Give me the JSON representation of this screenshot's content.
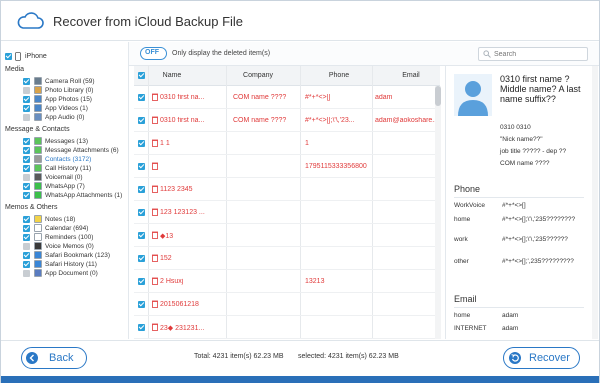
{
  "header": {
    "title": "Recover from iCloud Backup File"
  },
  "toolbar": {
    "toggle_label": "OFF",
    "toggle_desc": "Only display the deleted item(s)",
    "search_placeholder": "Search"
  },
  "sidebar": {
    "root": "iPhone",
    "sections": [
      {
        "title": "Media",
        "items": [
          {
            "label": "Camera Roll (59)",
            "checked": true,
            "icon_color": "#6a7d8e"
          },
          {
            "label": "Photo Library (0)",
            "checked": false,
            "icon_color": "#d8a24a"
          },
          {
            "label": "App Photos (15)",
            "checked": true,
            "icon_color": "#4a86c8"
          },
          {
            "label": "App Videos (1)",
            "checked": true,
            "icon_color": "#4a86c8"
          },
          {
            "label": "App Audio (0)",
            "checked": false,
            "icon_color": "#6a8fc0"
          }
        ]
      },
      {
        "title": "Message & Contacts",
        "items": [
          {
            "label": "Messages (13)",
            "checked": true,
            "icon_color": "#5cc45a"
          },
          {
            "label": "Message Attachments (6)",
            "checked": true,
            "icon_color": "#5cc45a"
          },
          {
            "label": "Contacts (3172)",
            "checked": true,
            "icon_color": "#9a9a9a",
            "selected": true
          },
          {
            "label": "Call History (11)",
            "checked": true,
            "icon_color": "#5cc45a"
          },
          {
            "label": "Voicemail (0)",
            "checked": false,
            "icon_color": "#5a5a5a"
          },
          {
            "label": "WhatsApp (7)",
            "checked": true,
            "icon_color": "#3cbf4b"
          },
          {
            "label": "WhatsApp Attachments (1)",
            "checked": true,
            "icon_color": "#3cbf4b"
          }
        ]
      },
      {
        "title": "Memos & Others",
        "items": [
          {
            "label": "Notes (18)",
            "checked": true,
            "icon_color": "#f2d34a"
          },
          {
            "label": "Calendar (694)",
            "checked": true,
            "icon_color": "#ffffff"
          },
          {
            "label": "Reminders (100)",
            "checked": true,
            "icon_color": "#ffffff"
          },
          {
            "label": "Voice Memos (0)",
            "checked": false,
            "icon_color": "#3a3a3a"
          },
          {
            "label": "Safari Bookmark (123)",
            "checked": true,
            "icon_color": "#3a86d6"
          },
          {
            "label": "Safari History (11)",
            "checked": true,
            "icon_color": "#3a86d6"
          },
          {
            "label": "App Document (0)",
            "checked": false,
            "icon_color": "#5a7cc0"
          }
        ]
      }
    ]
  },
  "table": {
    "columns": [
      "Name",
      "Company",
      "Phone",
      "Email"
    ],
    "rows": [
      {
        "name": "0310 first na...",
        "company": "COM name ????",
        "phone": "#*+*<>[]",
        "email": "adam"
      },
      {
        "name": "0310 first na...",
        "company": "COM name ????",
        "phone": "#*+*<>[];\\'\\,'23...",
        "email": "adam@aokoshare..."
      },
      {
        "name": "1 1",
        "company": "",
        "phone": "1",
        "email": ""
      },
      {
        "name": "",
        "company": "",
        "phone": "1795115333356800",
        "email": ""
      },
      {
        "name": "1123 2345",
        "company": "",
        "phone": "",
        "email": ""
      },
      {
        "name": "123 123123 ...",
        "company": "",
        "phone": "",
        "email": ""
      },
      {
        "name": "◆13",
        "company": "",
        "phone": "",
        "email": ""
      },
      {
        "name": "152",
        "company": "",
        "phone": "",
        "email": ""
      },
      {
        "name": "2 Hsuxj",
        "company": "",
        "phone": "13213",
        "email": ""
      },
      {
        "name": "2015061218",
        "company": "",
        "phone": "",
        "email": ""
      },
      {
        "name": "23◆ 231231...",
        "company": "",
        "phone": "",
        "email": ""
      },
      {
        "name": "33 3 4",
        "company": "",
        "phone": "4444",
        "email": ""
      }
    ]
  },
  "detail": {
    "name": "0310 first name ? Middle name? A last name suffix??",
    "line1": "0310 0310",
    "nick": "\"Nick name??\"",
    "job": "job title ????? - dep ??",
    "company": "COM name ????",
    "phone_title": "Phone",
    "phones": [
      {
        "label": "WorkVoice",
        "value": "#*+*<>[]"
      },
      {
        "label": "home",
        "value": "#*+*<>[];\\'\\,'235????????"
      },
      {
        "label": "work",
        "value": "#*+*<>[];\\'\\,'235??????"
      },
      {
        "label": "other",
        "value": "#*+*<>[];',235?????????"
      }
    ],
    "email_title": "Email",
    "emails": [
      {
        "label": "home",
        "value": "adam"
      },
      {
        "label": "INTERNET",
        "value": "adam"
      }
    ]
  },
  "footer": {
    "back_label": "Back",
    "total": "Total: 4231 item(s) 62.23 MB",
    "selected": "selected: 4231 item(s) 62.23 MB",
    "recover_label": "Recover"
  },
  "colors": {
    "accent": "#2a78c6",
    "checkbox": "#2aa0d8",
    "deleted_text": "#e03a3a",
    "bottom_bar": "#2a6fb8"
  }
}
